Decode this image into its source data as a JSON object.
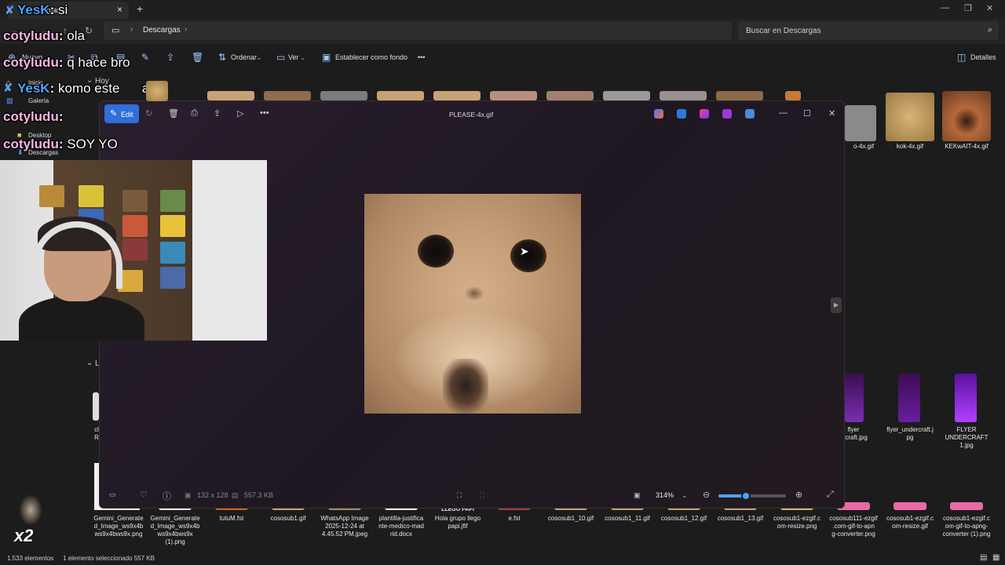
{
  "tabs": [
    {
      "label": "Descargas"
    }
  ],
  "address": {
    "location": "Descargas",
    "search_placeholder": "Buscar en Descargas"
  },
  "commandbar": {
    "new_label": "Nuevo",
    "sort_label": "Ordenar",
    "view_label": "Ver",
    "set_background_label": "Establecer como fondo",
    "more_label": "•••",
    "details_label": "Detalles"
  },
  "sidebar": {
    "items": [
      {
        "label": "Inicio",
        "icon": "home-icon"
      },
      {
        "label": "Galería",
        "icon": "gallery-icon"
      },
      {
        "label": "Desktop",
        "icon": "folder-icon"
      },
      {
        "label": "Descargas",
        "icon": "download-icon"
      }
    ]
  },
  "groups": {
    "today": "Hoy",
    "earlier": "L"
  },
  "top_files": [
    {
      "name": "o-4x.gif",
      "color": "#8a8a8a"
    },
    {
      "name": "kok-4x.gif",
      "color": "#c7a36b"
    },
    {
      "name": "KEKwAIT-4x.gif",
      "color": "#b46a3c"
    }
  ],
  "mid_files": [
    {
      "name": "flyer\nercraft.jpg",
      "color": "#5a1a7a"
    },
    {
      "name": "flyer_undercraft.j\npg",
      "color": "#4a1670"
    },
    {
      "name": "FLYER\nUNDERCRAFT\n1.jpg",
      "color": "#6a1ea0"
    }
  ],
  "partial_left_files": [
    {
      "name": "cl\nR"
    }
  ],
  "bottom_files": [
    {
      "name": "Gemini_Generate\nd_Image_ws9x4b\nws9x4bws9x.png"
    },
    {
      "name": "Gemini_Generate\nd_Image_ws9x4b\nws9x4bws9x\n(1).png"
    },
    {
      "name": "tutuM.fst"
    },
    {
      "name": "cososub1.gif"
    },
    {
      "name": "WhatsApp Image\n2025-12-24 at\n4.45.52 PM.jpeg"
    },
    {
      "name": "plantilla-justifica\nnte-medico-mad\nrid.docx"
    },
    {
      "name": "Hola grupo llego\npapi.jfif"
    },
    {
      "name": "e.fst"
    },
    {
      "name": "cososub1_10.gif"
    },
    {
      "name": "cososub1_11.gif"
    },
    {
      "name": "cososub1_12.gif"
    },
    {
      "name": "cososub1_13.gif"
    },
    {
      "name": "cososub1-ezgif.c\nom-resize.png"
    },
    {
      "name": "cososub111-ezgif\n.com-gif-to-apn\ng-converter.png"
    },
    {
      "name": "cososub1-ezgif.c\nom-resize.gif"
    },
    {
      "name": "cososub1-ezgif.c\nom-gif-to-apng-\nconverter (1).png"
    }
  ],
  "bottom_thumb_caption": "LLEGO PAPI",
  "status": {
    "count": "1.533 elementos",
    "selection": "1 elemento seleccionado  557 KB"
  },
  "viewer": {
    "edit_label": "Edit",
    "title": "PLEASE-4x.gif",
    "dimensions": "132 x 128",
    "filesize": "557.3 KB",
    "zoom": "314%",
    "zoom_fraction": 0.41
  },
  "chat": [
    {
      "user": "YesK",
      "sep": ": ",
      "message": "si",
      "style": "b"
    },
    {
      "user": "cotyludu",
      "sep": ": ",
      "message": "ola",
      "style": "a"
    },
    {
      "user": "cotyludu",
      "sep": ": ",
      "message": "q hace bro",
      "style": "a"
    },
    {
      "user": "YesK",
      "sep": ": ",
      "message": "komo este      ads",
      "style": "b"
    },
    {
      "user": "cotyludu",
      "sep": ":",
      "message": "",
      "style": "a"
    },
    {
      "user": "cotyludu",
      "sep": ": ",
      "message": "SOY YO",
      "style": "a"
    }
  ],
  "multiplier": "x2"
}
